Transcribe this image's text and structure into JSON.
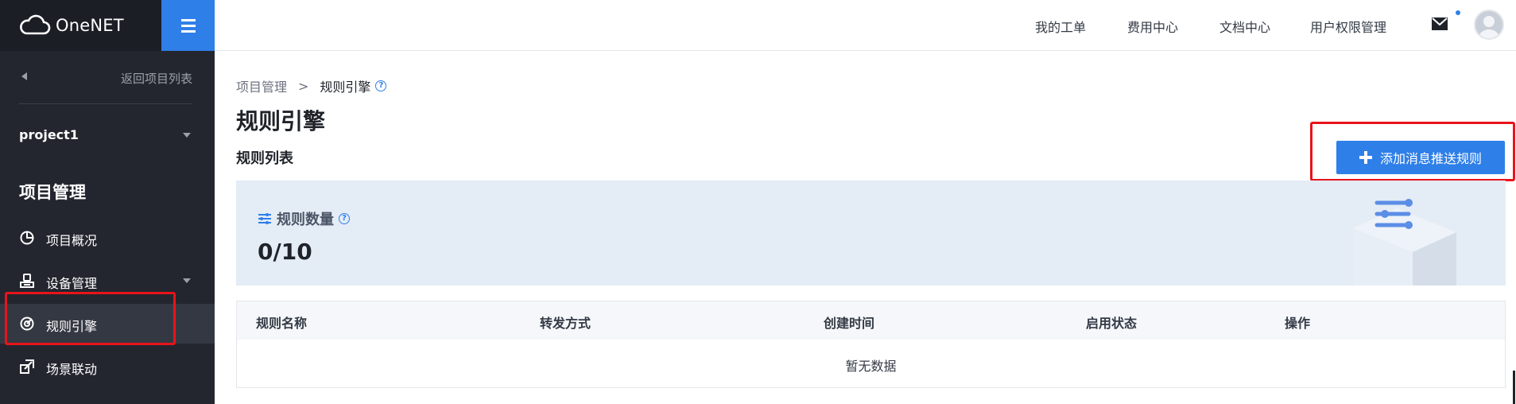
{
  "brand": {
    "name": "OneNET"
  },
  "sidebar": {
    "back_label": "返回项目列表",
    "project": {
      "name": "project1"
    },
    "section_title": "项目管理",
    "items": [
      {
        "label": "项目概况",
        "icon": "pie-chart-icon",
        "active": false,
        "expandable": false
      },
      {
        "label": "设备管理",
        "icon": "device-icon",
        "active": false,
        "expandable": true
      },
      {
        "label": "规则引擎",
        "icon": "rule-target-icon",
        "active": true,
        "expandable": false
      },
      {
        "label": "场景联动",
        "icon": "scene-link-icon",
        "active": false,
        "expandable": false
      }
    ]
  },
  "header": {
    "links": [
      "我的工单",
      "费用中心",
      "文档中心",
      "用户权限管理"
    ],
    "mail_icon": "mail-icon",
    "avatar_icon": "user-avatar-icon"
  },
  "main": {
    "breadcrumb": {
      "parent": "项目管理",
      "separator": ">",
      "current": "规则引擎"
    },
    "title": "规则引擎",
    "list_title": "规则列表",
    "add_button_label": "添加消息推送规则",
    "stat": {
      "label": "规则数量",
      "value": "0/10"
    },
    "table": {
      "columns": [
        "规则名称",
        "转发方式",
        "创建时间",
        "启用状态",
        "操作"
      ],
      "empty_text": "暂无数据"
    }
  },
  "colors": {
    "primary": "#2f7fe8",
    "sidebar_bg": "#23262f",
    "highlight_annotation": "#e8141b",
    "stat_card_bg": "#e4ecf6"
  }
}
